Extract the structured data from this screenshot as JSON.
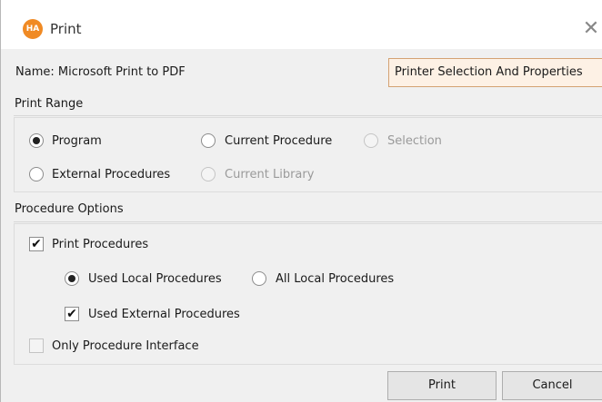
{
  "window": {
    "title": "Print",
    "app_icon_text": "HA",
    "close_symbol": "✕"
  },
  "printer": {
    "name_label": "Name: Microsoft Print to PDF",
    "selection_button": "Printer Selection And Properties"
  },
  "print_range": {
    "label": "Print Range",
    "options": [
      {
        "label": "Program",
        "selected": true,
        "disabled": false
      },
      {
        "label": "Current Procedure",
        "selected": false,
        "disabled": false
      },
      {
        "label": "Selection",
        "selected": false,
        "disabled": true
      },
      {
        "label": "External Procedures",
        "selected": false,
        "disabled": false
      },
      {
        "label": "Current Library",
        "selected": false,
        "disabled": true
      }
    ]
  },
  "procedure_options": {
    "label": "Procedure Options",
    "print_procedures": {
      "label": "Print Procedures",
      "checked": true
    },
    "local_scope": [
      {
        "label": "Used Local Procedures",
        "selected": true
      },
      {
        "label": "All Local Procedures",
        "selected": false
      }
    ],
    "used_external": {
      "label": "Used External Procedures",
      "checked": true
    },
    "only_interface": {
      "label": "Only Procedure Interface",
      "checked": false
    }
  },
  "footer": {
    "print_button": "Print",
    "cancel_button": "Cancel"
  },
  "check_mark": "✔"
}
